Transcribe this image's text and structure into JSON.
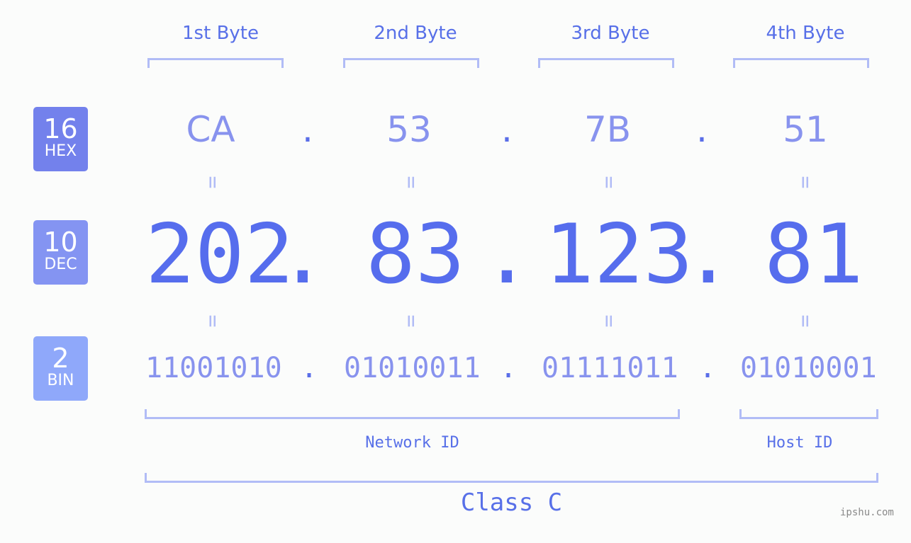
{
  "bytes": {
    "labels": [
      "1st Byte",
      "2nd Byte",
      "3rd Byte",
      "4th Byte"
    ]
  },
  "badges": {
    "hex": {
      "base": "16",
      "label": "HEX",
      "color": "#7381ec"
    },
    "dec": {
      "base": "10",
      "label": "DEC",
      "color": "#8494f2"
    },
    "bin": {
      "base": "2",
      "label": "BIN",
      "color": "#8fa8fa"
    }
  },
  "hex": {
    "values": [
      "CA",
      "53",
      "7B",
      "51"
    ],
    "separator": "."
  },
  "dec": {
    "values": [
      "202",
      "83",
      "123",
      "81"
    ],
    "separator": "."
  },
  "bin": {
    "values": [
      "11001010",
      "01010011",
      "01111011",
      "01010001"
    ],
    "separator": "."
  },
  "equals": "=",
  "network_id_label": "Network ID",
  "host_id_label": "Host ID",
  "class_label": "Class C",
  "watermark": "ipshu.com",
  "colors": {
    "accent": "#566ded",
    "light_accent": "#8893ee",
    "bracket": "#b1bcf6"
  }
}
